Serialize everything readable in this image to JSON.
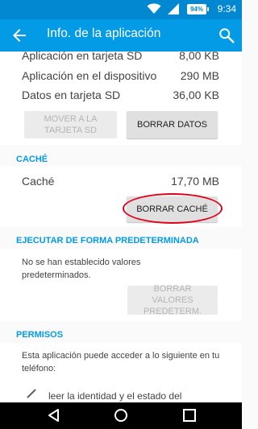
{
  "status_bar": {
    "time": "9:34",
    "battery": "94%"
  },
  "app_bar": {
    "title": "Info. de la aplicación"
  },
  "storage": {
    "rows": [
      {
        "label": "Aplicación en tarjeta SD",
        "value": "8,00 KB"
      },
      {
        "label": "Aplicación en el dispositivo",
        "value": "290 MB"
      },
      {
        "label": "Datos en tarjeta SD",
        "value": "36,00 KB"
      }
    ],
    "move_button": "MOVER A LA TARJETA SD",
    "clear_data_button": "BORRAR DATOS"
  },
  "cache": {
    "header": "CACHÉ",
    "label": "Caché",
    "value": "17,70 MB",
    "clear_cache_button": "BORRAR CACHÉ"
  },
  "defaults": {
    "header": "EJECUTAR DE FORMA PREDETERMINADA",
    "text": "No se han establecido valores predeterminados.",
    "clear_defaults_button": "BORRAR VALORES PREDETERM."
  },
  "permissions": {
    "header": "PERMISOS",
    "text": "Esta aplicación puede acceder a lo siguiente en tu teléfono:",
    "first_item": "leer la identidad y el estado del"
  },
  "colors": {
    "primary": "#039be5",
    "primary_dark": "#0288d1",
    "highlight": "#e2001a"
  }
}
